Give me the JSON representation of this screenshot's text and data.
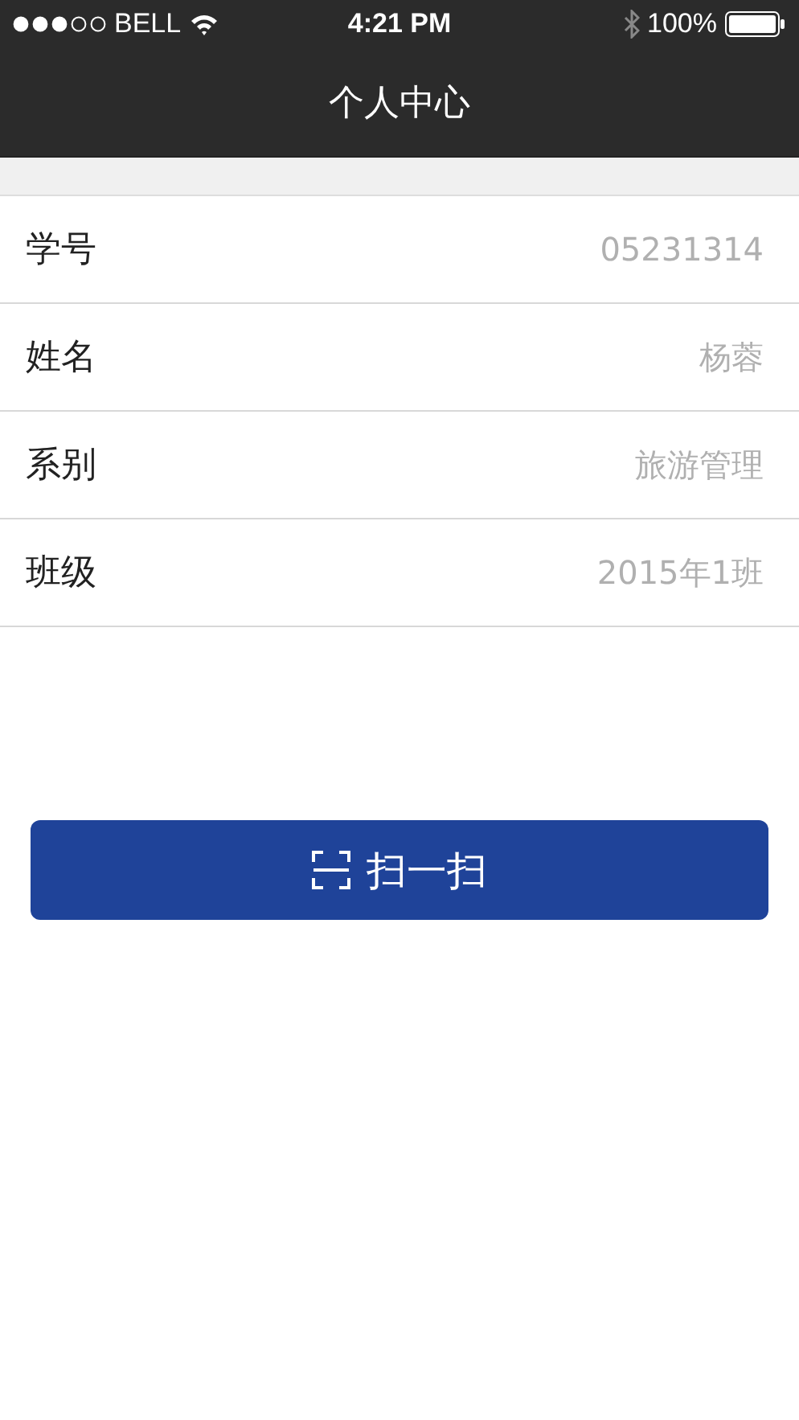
{
  "status_bar": {
    "carrier": "BELL",
    "time": "4:21 PM",
    "battery": "100%"
  },
  "nav": {
    "title": "个人中心"
  },
  "fields": [
    {
      "label": "学号",
      "value": "05231314"
    },
    {
      "label": "姓名",
      "value": "杨蓉"
    },
    {
      "label": "系别",
      "value": "旅游管理"
    },
    {
      "label": "班级",
      "value": "2015年1班"
    }
  ],
  "scan_button": {
    "label": "扫一扫"
  }
}
